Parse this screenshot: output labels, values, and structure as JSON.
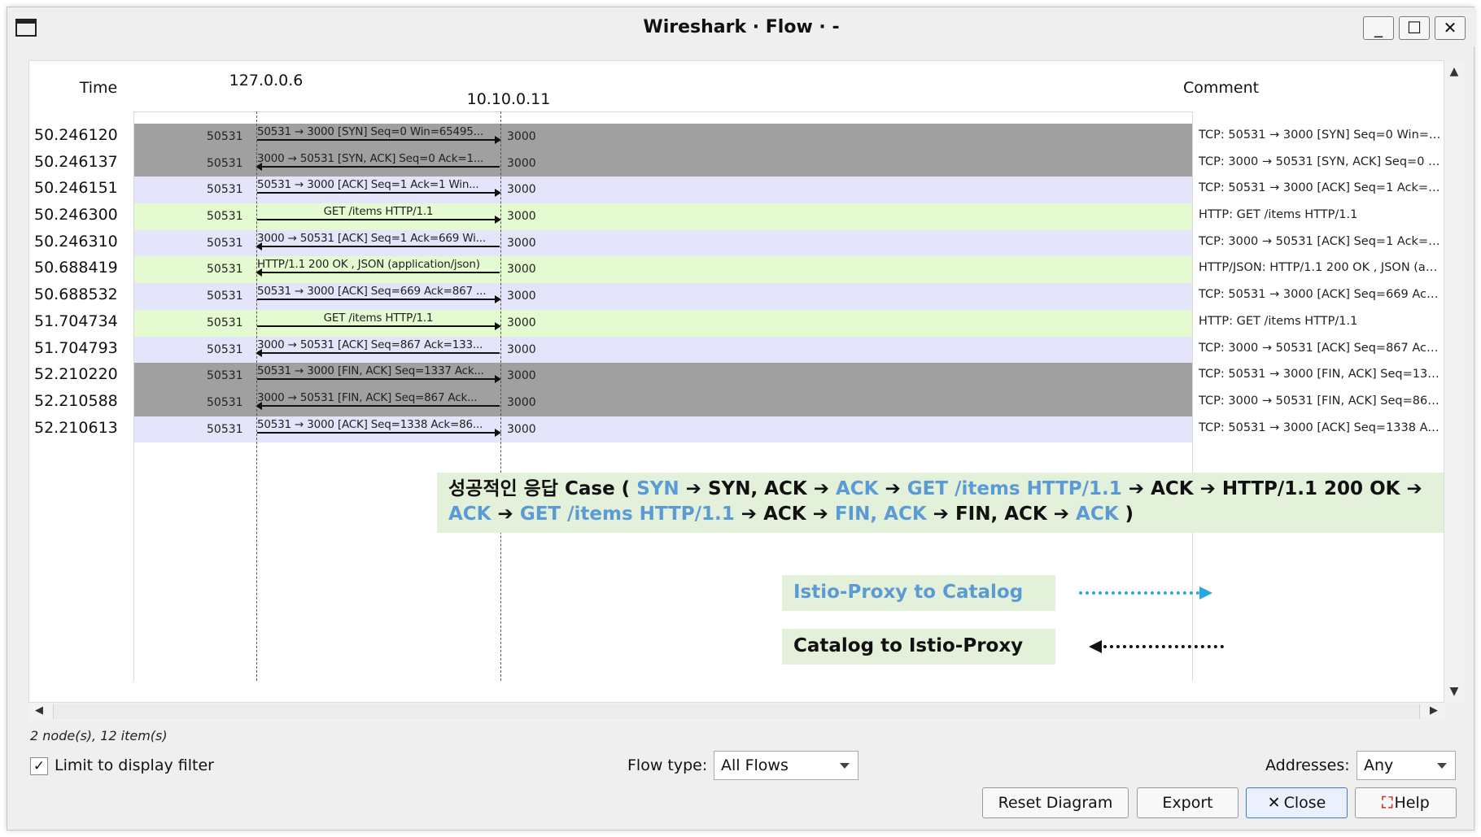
{
  "window": {
    "title": "Wireshark · Flow · -"
  },
  "window_controls": {
    "minimize": "_",
    "maximize": "☐",
    "close": "✕"
  },
  "columns": {
    "time": "Time",
    "node_a": "127.0.0.6",
    "node_b": "10.10.0.11",
    "comment": "Comment"
  },
  "rows": [
    {
      "time": "50.246120",
      "port_a": "50531",
      "port_b": "3000",
      "label": "50531 → 3000 [SYN] Seq=0 Win=65495...",
      "comment": "TCP: 50531 → 3000 [SYN] Seq=0 Win=65...",
      "dir": "right",
      "kind": "dark"
    },
    {
      "time": "50.246137",
      "port_a": "50531",
      "port_b": "3000",
      "label": "3000 → 50531 [SYN, ACK] Seq=0 Ack=1...",
      "comment": "TCP: 3000 → 50531 [SYN, ACK] Seq=0 Ack...",
      "dir": "left",
      "kind": "dark"
    },
    {
      "time": "50.246151",
      "port_a": "50531",
      "port_b": "3000",
      "label": "50531 → 3000 [ACK] Seq=1 Ack=1 Win...",
      "comment": "TCP: 50531 → 3000 [ACK] Seq=1 Ack=1 ...",
      "dir": "right",
      "kind": "tcp"
    },
    {
      "time": "50.246300",
      "port_a": "50531",
      "port_b": "3000",
      "label": "GET /items HTTP/1.1",
      "comment": "HTTP: GET /items HTTP/1.1",
      "dir": "right",
      "kind": "http"
    },
    {
      "time": "50.246310",
      "port_a": "50531",
      "port_b": "3000",
      "label": "3000 → 50531 [ACK] Seq=1 Ack=669 Wi...",
      "comment": "TCP: 3000 → 50531 [ACK] Seq=1 Ack=66...",
      "dir": "left",
      "kind": "tcp"
    },
    {
      "time": "50.688419",
      "port_a": "50531",
      "port_b": "3000",
      "label": "HTTP/1.1 200 OK , JSON (application/json)",
      "comment": "HTTP/JSON: HTTP/1.1 200 OK , JSON (appli...",
      "dir": "left",
      "kind": "http"
    },
    {
      "time": "50.688532",
      "port_a": "50531",
      "port_b": "3000",
      "label": "50531 → 3000 [ACK] Seq=669 Ack=867 ...",
      "comment": "TCP: 50531 → 3000 [ACK] Seq=669 Ack=...",
      "dir": "right",
      "kind": "tcp"
    },
    {
      "time": "51.704734",
      "port_a": "50531",
      "port_b": "3000",
      "label": "GET /items HTTP/1.1",
      "comment": "HTTP: GET /items HTTP/1.1",
      "dir": "right",
      "kind": "http"
    },
    {
      "time": "51.704793",
      "port_a": "50531",
      "port_b": "3000",
      "label": "3000 → 50531 [ACK] Seq=867 Ack=133...",
      "comment": "TCP: 3000 → 50531 [ACK] Seq=867 Ack=...",
      "dir": "left",
      "kind": "tcp"
    },
    {
      "time": "52.210220",
      "port_a": "50531",
      "port_b": "3000",
      "label": "50531 → 3000 [FIN, ACK] Seq=1337 Ack...",
      "comment": "TCP: 50531 → 3000 [FIN, ACK] Seq=1337 ...",
      "dir": "right",
      "kind": "dark"
    },
    {
      "time": "52.210588",
      "port_a": "50531",
      "port_b": "3000",
      "label": "3000 → 50531 [FIN, ACK] Seq=867 Ack...",
      "comment": "TCP: 3000 → 50531 [FIN, ACK] Seq=867 A...",
      "dir": "left",
      "kind": "dark"
    },
    {
      "time": "52.210613",
      "port_a": "50531",
      "port_b": "3000",
      "label": "50531 → 3000 [ACK] Seq=1338 Ack=86...",
      "comment": "TCP: 50531 → 3000 [ACK] Seq=1338 Ack...",
      "dir": "right",
      "kind": "tcp"
    }
  ],
  "annotation": {
    "prefix": "성공적인 응답 Case ( ",
    "steps": [
      {
        "text": "SYN",
        "blue": true
      },
      {
        "text": "SYN, ACK",
        "blue": false
      },
      {
        "text": "ACK",
        "blue": true
      },
      {
        "text": "GET /items HTTP/1.1",
        "blue": true
      },
      {
        "text": "ACK",
        "blue": false
      },
      {
        "text": "HTTP/1.1 200 OK",
        "blue": false
      },
      {
        "text": "ACK",
        "blue": true
      },
      {
        "text": "GET /items HTTP/1.1",
        "blue": true
      },
      {
        "text": "ACK",
        "blue": false
      },
      {
        "text": "FIN, ACK",
        "blue": true
      },
      {
        "text": "FIN, ACK",
        "blue": false
      },
      {
        "text": "ACK",
        "blue": true
      }
    ],
    "suffix": " )",
    "separator": " ➔ "
  },
  "legend": {
    "proxy_to_catalog": "Istio-Proxy to Catalog",
    "catalog_to_proxy": "Catalog to Istio-Proxy"
  },
  "colors": {
    "tcp_row": "#e4e4fa",
    "http_row": "#e4fbd2",
    "dark_row": "#a0a0a0",
    "highlight": "#5b9bd5",
    "legend_arrow": "#29a7df"
  },
  "scroll": {
    "up": "▲",
    "down": "▼",
    "left": "◀",
    "right": "▶"
  },
  "status": "2 node(s), 12 item(s)",
  "controls": {
    "limit_checked": "✓",
    "limit_label": "Limit to display filter",
    "flow_type_label": "Flow type:",
    "flow_type_value": "All Flows",
    "addresses_label": "Addresses:",
    "addresses_value": "Any"
  },
  "buttons": {
    "reset": "Reset Diagram",
    "export": "Export",
    "close": "Close",
    "help": "Help",
    "close_icon": "✕",
    "help_icon": "⛶"
  }
}
